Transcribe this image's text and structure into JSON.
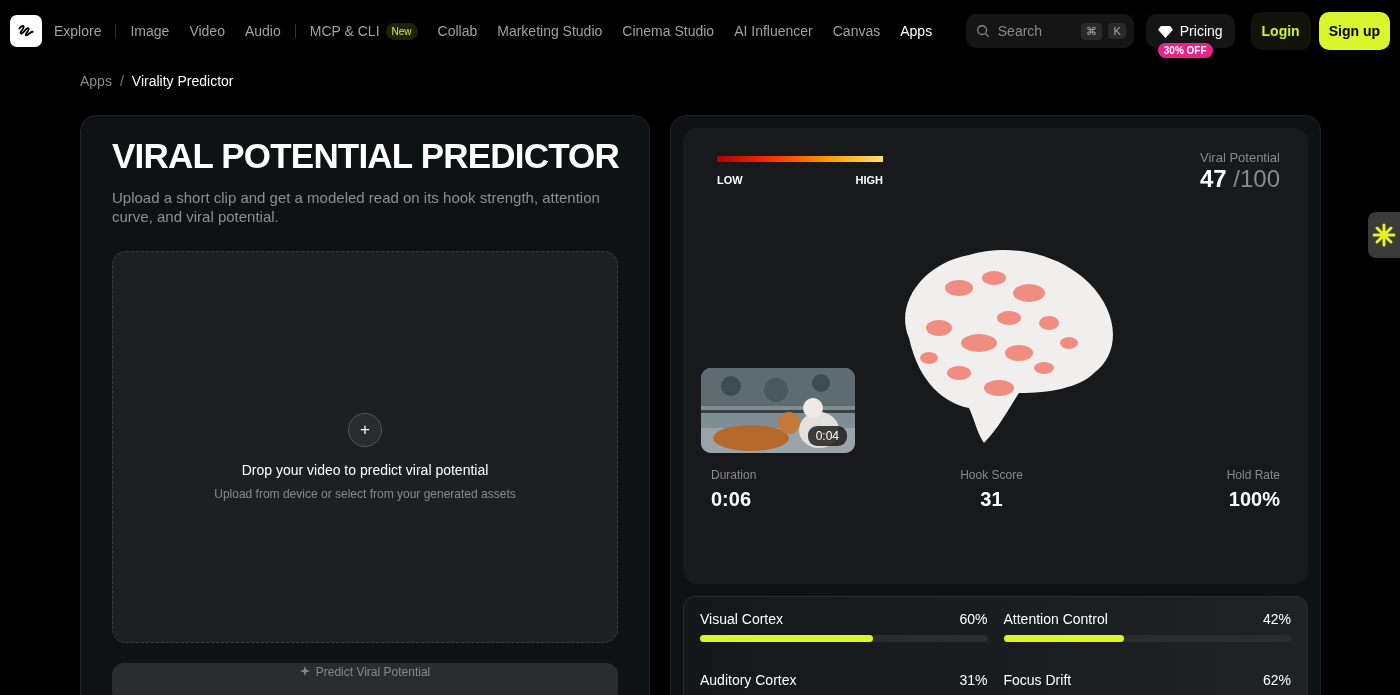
{
  "nav": {
    "items": [
      {
        "label": "Explore",
        "selected": false,
        "divider_after": true
      },
      {
        "label": "Image",
        "selected": false,
        "divider_after": false
      },
      {
        "label": "Video",
        "selected": false,
        "divider_after": false
      },
      {
        "label": "Audio",
        "selected": false,
        "divider_after": true
      },
      {
        "label": "MCP & CLI",
        "selected": false,
        "badge": "New",
        "divider_after": false
      },
      {
        "label": "Collab",
        "selected": false,
        "divider_after": false
      },
      {
        "label": "Marketing Studio",
        "selected": false,
        "divider_after": false
      },
      {
        "label": "Cinema Studio",
        "selected": false,
        "divider_after": false
      },
      {
        "label": "AI Influencer",
        "selected": false,
        "divider_after": false
      },
      {
        "label": "Canvas",
        "selected": false,
        "divider_after": false
      },
      {
        "label": "Apps",
        "selected": true,
        "divider_after": false
      }
    ],
    "search": {
      "placeholder": "Search",
      "keys": [
        "⌘",
        "K"
      ]
    },
    "pricing": {
      "label": "Pricing",
      "badge": "30% OFF"
    },
    "login": "Login",
    "signup": "Sign up"
  },
  "breadcrumb": [
    {
      "label": "Apps",
      "current": false
    },
    {
      "label": "Virality Predictor",
      "current": true
    }
  ],
  "breadcrumb_separator": "/",
  "upload_card": {
    "title": "VIRAL POTENTIAL PREDICTOR",
    "subtitle": "Upload a short clip and get a modeled read on its hook strength, attention curve, and viral potential.",
    "dropzone": {
      "icon": "+",
      "title": "Drop your video to predict viral potential",
      "hint": "Upload from device or select from your generated assets"
    },
    "button": "Predict Viral Potential"
  },
  "result": {
    "legend": {
      "low": "LOW",
      "high": "HIGH"
    },
    "score_label": "Viral Potential",
    "score": "47",
    "score_max": "/100",
    "video": {
      "kind": "picture",
      "time": "0:04"
    },
    "stats": [
      {
        "label": "Duration",
        "value": "0:06"
      },
      {
        "label": "Hook Score",
        "value": "31"
      },
      {
        "label": "Hold Rate",
        "value": "100%"
      }
    ],
    "regions": [
      {
        "name": "Visual Cortex",
        "reading": "60%",
        "level": 0.6
      },
      {
        "name": "Attention Control",
        "reading": "42%",
        "level": 0.42
      },
      {
        "name": "Auditory Cortex",
        "reading": "31%"
      },
      {
        "name": "Focus Drift",
        "reading": "62%"
      }
    ]
  }
}
